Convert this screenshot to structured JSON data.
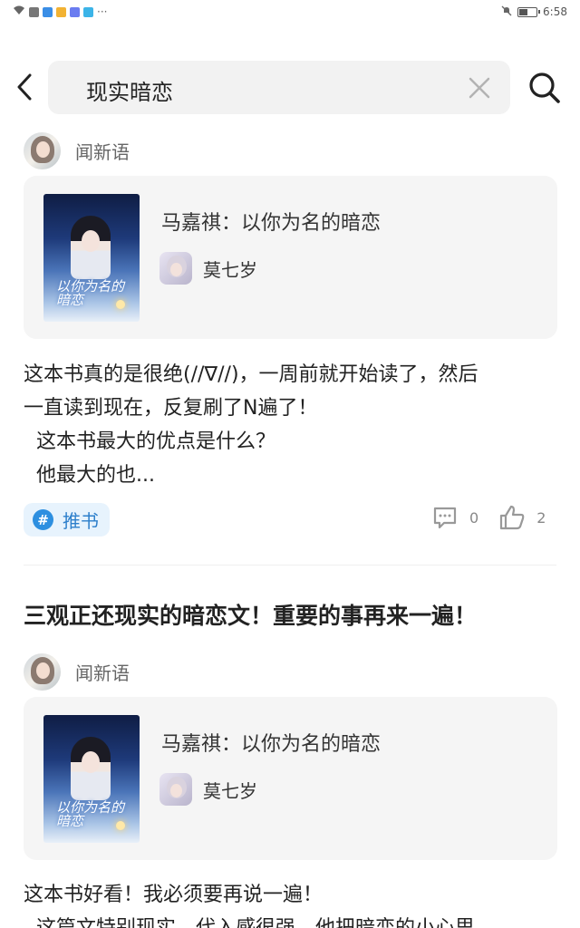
{
  "status_bar": {
    "time": "6:58",
    "battery_level": 0.5
  },
  "search": {
    "query": "现实暗恋"
  },
  "posts": [
    {
      "author": "闻新语",
      "book": {
        "title": "马嘉祺：以你为名的暗恋",
        "cover_text": "以你为名的暗恋",
        "author": "莫七岁"
      },
      "body": [
        "这本书真的是很绝(//∇//)，一周前就开始读了，然后",
        "一直读到现在，反复刷了N遍了！",
        "  这本书最大的优点是什么？",
        "  他最大的也..."
      ],
      "tag": "推书",
      "comments": "0",
      "likes": "2"
    },
    {
      "title": "三观正还现实的暗恋文！重要的事再来一遍！",
      "author": "闻新语",
      "book": {
        "title": "马嘉祺：以你为名的暗恋",
        "cover_text": "以你为名的暗恋",
        "author": "莫七岁"
      },
      "body": [
        "这本书好看！我必须要再说一遍！",
        "  这篇文特别现实，代入感很强，他把暗恋的小心思"
      ]
    }
  ],
  "colors": {
    "accent": "#2d8fe0",
    "tag_bg": "#e7f3fd",
    "card_bg": "#f5f5f5"
  }
}
